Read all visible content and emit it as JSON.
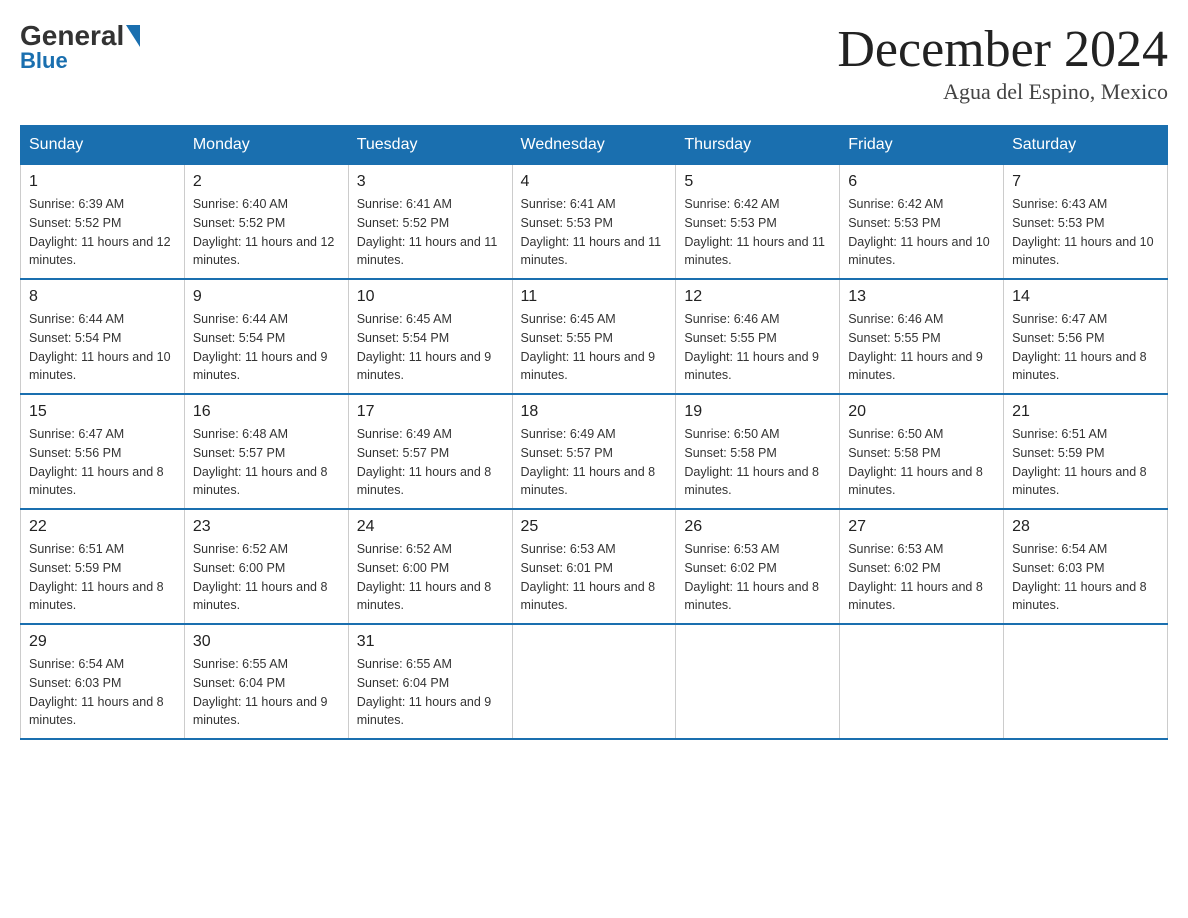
{
  "header": {
    "logo_general": "General",
    "logo_blue": "Blue",
    "month_title": "December 2024",
    "location": "Agua del Espino, Mexico"
  },
  "calendar": {
    "days_of_week": [
      "Sunday",
      "Monday",
      "Tuesday",
      "Wednesday",
      "Thursday",
      "Friday",
      "Saturday"
    ],
    "weeks": [
      [
        {
          "day": "1",
          "sunrise": "6:39 AM",
          "sunset": "5:52 PM",
          "daylight": "11 hours and 12 minutes."
        },
        {
          "day": "2",
          "sunrise": "6:40 AM",
          "sunset": "5:52 PM",
          "daylight": "11 hours and 12 minutes."
        },
        {
          "day": "3",
          "sunrise": "6:41 AM",
          "sunset": "5:52 PM",
          "daylight": "11 hours and 11 minutes."
        },
        {
          "day": "4",
          "sunrise": "6:41 AM",
          "sunset": "5:53 PM",
          "daylight": "11 hours and 11 minutes."
        },
        {
          "day": "5",
          "sunrise": "6:42 AM",
          "sunset": "5:53 PM",
          "daylight": "11 hours and 11 minutes."
        },
        {
          "day": "6",
          "sunrise": "6:42 AM",
          "sunset": "5:53 PM",
          "daylight": "11 hours and 10 minutes."
        },
        {
          "day": "7",
          "sunrise": "6:43 AM",
          "sunset": "5:53 PM",
          "daylight": "11 hours and 10 minutes."
        }
      ],
      [
        {
          "day": "8",
          "sunrise": "6:44 AM",
          "sunset": "5:54 PM",
          "daylight": "11 hours and 10 minutes."
        },
        {
          "day": "9",
          "sunrise": "6:44 AM",
          "sunset": "5:54 PM",
          "daylight": "11 hours and 9 minutes."
        },
        {
          "day": "10",
          "sunrise": "6:45 AM",
          "sunset": "5:54 PM",
          "daylight": "11 hours and 9 minutes."
        },
        {
          "day": "11",
          "sunrise": "6:45 AM",
          "sunset": "5:55 PM",
          "daylight": "11 hours and 9 minutes."
        },
        {
          "day": "12",
          "sunrise": "6:46 AM",
          "sunset": "5:55 PM",
          "daylight": "11 hours and 9 minutes."
        },
        {
          "day": "13",
          "sunrise": "6:46 AM",
          "sunset": "5:55 PM",
          "daylight": "11 hours and 9 minutes."
        },
        {
          "day": "14",
          "sunrise": "6:47 AM",
          "sunset": "5:56 PM",
          "daylight": "11 hours and 8 minutes."
        }
      ],
      [
        {
          "day": "15",
          "sunrise": "6:47 AM",
          "sunset": "5:56 PM",
          "daylight": "11 hours and 8 minutes."
        },
        {
          "day": "16",
          "sunrise": "6:48 AM",
          "sunset": "5:57 PM",
          "daylight": "11 hours and 8 minutes."
        },
        {
          "day": "17",
          "sunrise": "6:49 AM",
          "sunset": "5:57 PM",
          "daylight": "11 hours and 8 minutes."
        },
        {
          "day": "18",
          "sunrise": "6:49 AM",
          "sunset": "5:57 PM",
          "daylight": "11 hours and 8 minutes."
        },
        {
          "day": "19",
          "sunrise": "6:50 AM",
          "sunset": "5:58 PM",
          "daylight": "11 hours and 8 minutes."
        },
        {
          "day": "20",
          "sunrise": "6:50 AM",
          "sunset": "5:58 PM",
          "daylight": "11 hours and 8 minutes."
        },
        {
          "day": "21",
          "sunrise": "6:51 AM",
          "sunset": "5:59 PM",
          "daylight": "11 hours and 8 minutes."
        }
      ],
      [
        {
          "day": "22",
          "sunrise": "6:51 AM",
          "sunset": "5:59 PM",
          "daylight": "11 hours and 8 minutes."
        },
        {
          "day": "23",
          "sunrise": "6:52 AM",
          "sunset": "6:00 PM",
          "daylight": "11 hours and 8 minutes."
        },
        {
          "day": "24",
          "sunrise": "6:52 AM",
          "sunset": "6:00 PM",
          "daylight": "11 hours and 8 minutes."
        },
        {
          "day": "25",
          "sunrise": "6:53 AM",
          "sunset": "6:01 PM",
          "daylight": "11 hours and 8 minutes."
        },
        {
          "day": "26",
          "sunrise": "6:53 AM",
          "sunset": "6:02 PM",
          "daylight": "11 hours and 8 minutes."
        },
        {
          "day": "27",
          "sunrise": "6:53 AM",
          "sunset": "6:02 PM",
          "daylight": "11 hours and 8 minutes."
        },
        {
          "day": "28",
          "sunrise": "6:54 AM",
          "sunset": "6:03 PM",
          "daylight": "11 hours and 8 minutes."
        }
      ],
      [
        {
          "day": "29",
          "sunrise": "6:54 AM",
          "sunset": "6:03 PM",
          "daylight": "11 hours and 8 minutes."
        },
        {
          "day": "30",
          "sunrise": "6:55 AM",
          "sunset": "6:04 PM",
          "daylight": "11 hours and 9 minutes."
        },
        {
          "day": "31",
          "sunrise": "6:55 AM",
          "sunset": "6:04 PM",
          "daylight": "11 hours and 9 minutes."
        },
        null,
        null,
        null,
        null
      ]
    ]
  }
}
